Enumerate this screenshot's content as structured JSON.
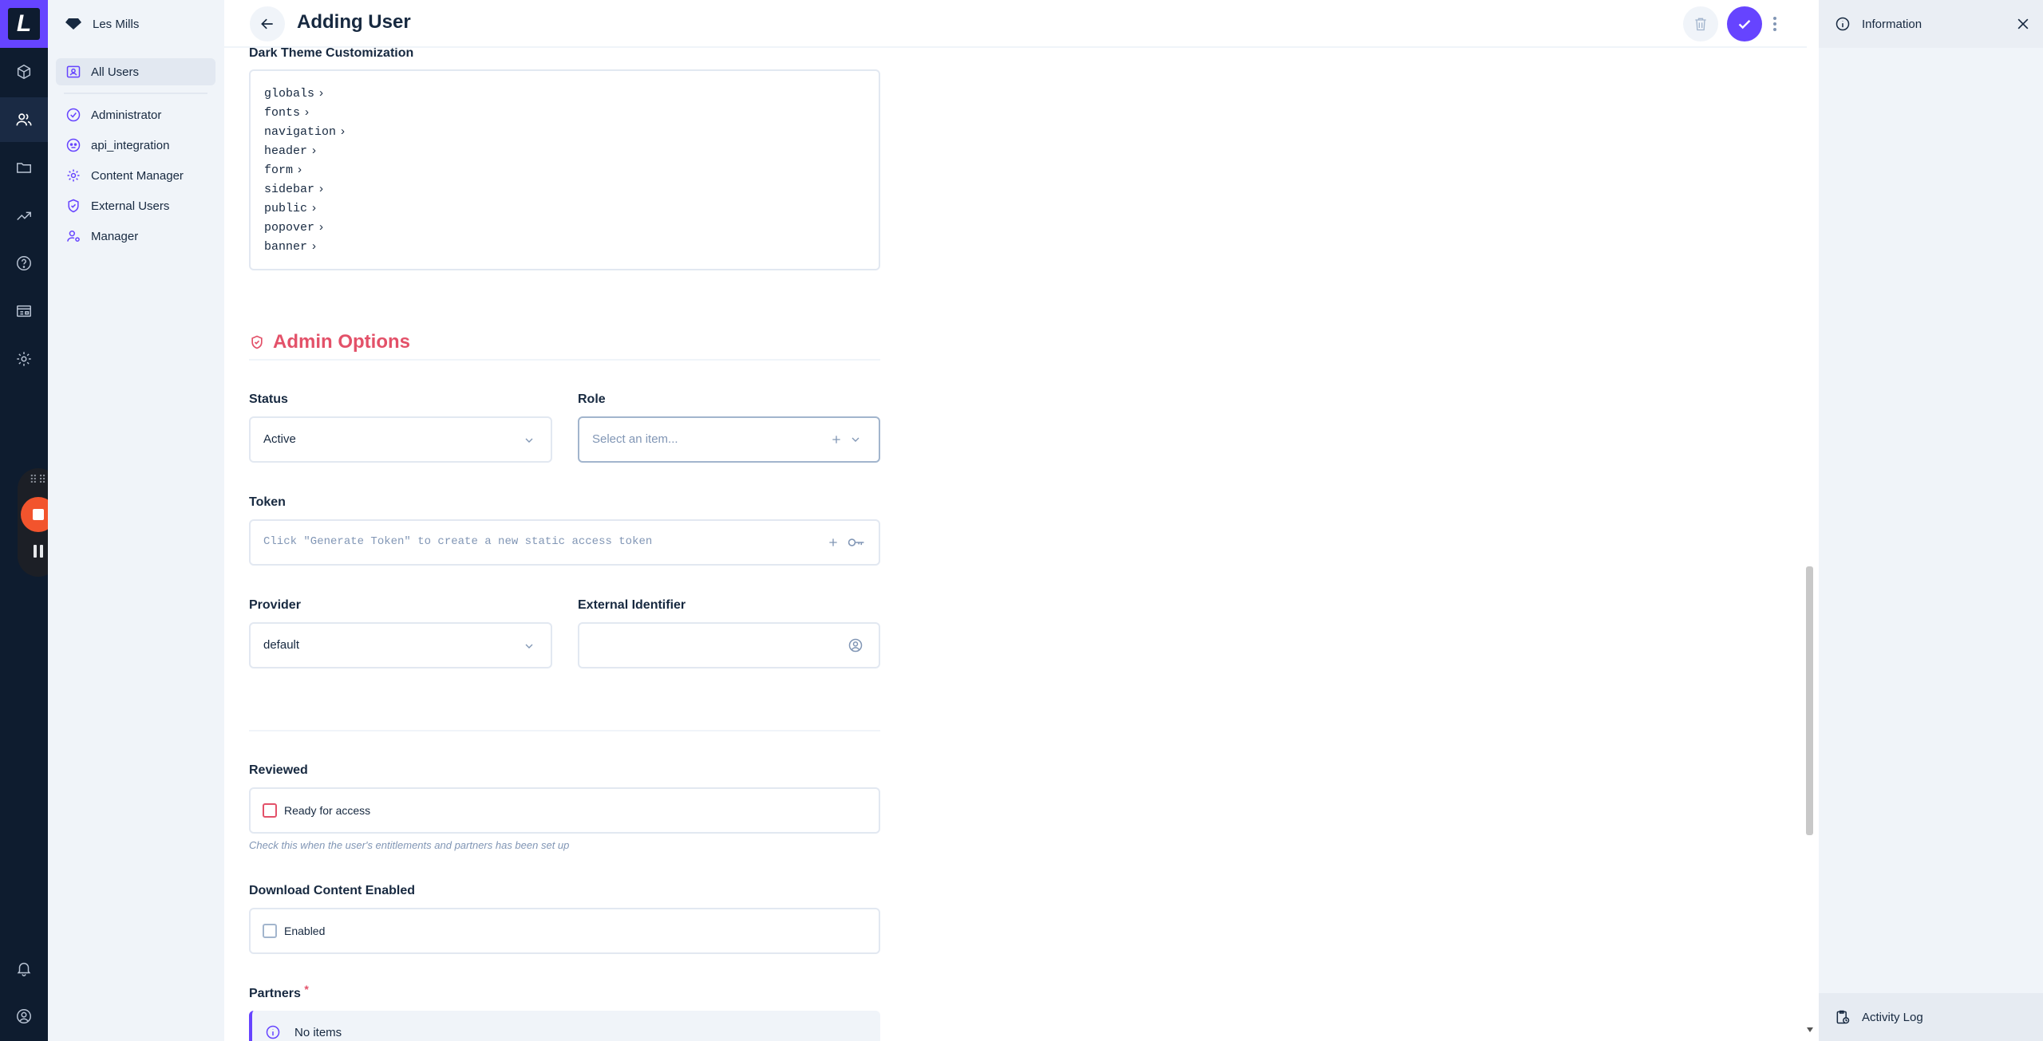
{
  "project": {
    "name": "Les Mills"
  },
  "logo": {
    "letter": "L"
  },
  "nav": {
    "all_users": "All Users",
    "roles": [
      "Administrator",
      "api_integration",
      "Content Manager",
      "External Users",
      "Manager"
    ]
  },
  "header": {
    "title": "Adding User"
  },
  "form": {
    "dark_theme": {
      "label": "Dark Theme Customization",
      "keys": [
        "globals",
        "fonts",
        "navigation",
        "header",
        "form",
        "sidebar",
        "public",
        "popover",
        "banner"
      ]
    },
    "admin_options": {
      "title": "Admin Options"
    },
    "status": {
      "label": "Status",
      "value": "Active"
    },
    "role": {
      "label": "Role",
      "placeholder": "Select an item..."
    },
    "token": {
      "label": "Token",
      "placeholder": "Click \"Generate Token\" to create a new static access token"
    },
    "provider": {
      "label": "Provider",
      "value": "default"
    },
    "external_identifier": {
      "label": "External Identifier",
      "value": ""
    },
    "reviewed": {
      "label": "Reviewed",
      "checkbox_label": "Ready for access",
      "hint": "Check this when the user's entitlements and partners has been set up"
    },
    "download": {
      "label": "Download Content Enabled",
      "checkbox_label": "Enabled"
    },
    "partners": {
      "label": "Partners",
      "required": "*",
      "empty": "No items"
    }
  },
  "info_sidebar": {
    "title": "Information",
    "activity_log": "Activity Log"
  },
  "colors": {
    "accent": "#6644ff",
    "danger": "#e35169",
    "rail": "#0e1c2f",
    "sidebar": "#f0f4f9"
  }
}
